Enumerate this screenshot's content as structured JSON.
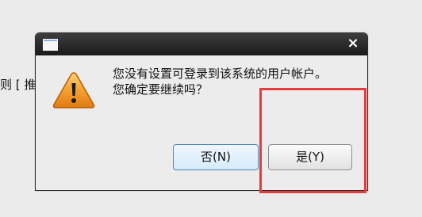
{
  "background": {
    "partial_text": "则 [ 推"
  },
  "dialog": {
    "title": "",
    "message_line1": "您没有设置可登录到该系统的用户帐户。",
    "message_line2": "您确定要继续吗？",
    "no_button_label": "否(N)",
    "yes_button_label": "是(Y)",
    "close_glyph": "×"
  },
  "icons": {
    "warning": "warning-icon",
    "app": "window-icon",
    "close": "close-icon"
  },
  "colors": {
    "highlight": "#e63b3b",
    "warning_orange": "#f39c12",
    "titlebar": "#222222"
  }
}
